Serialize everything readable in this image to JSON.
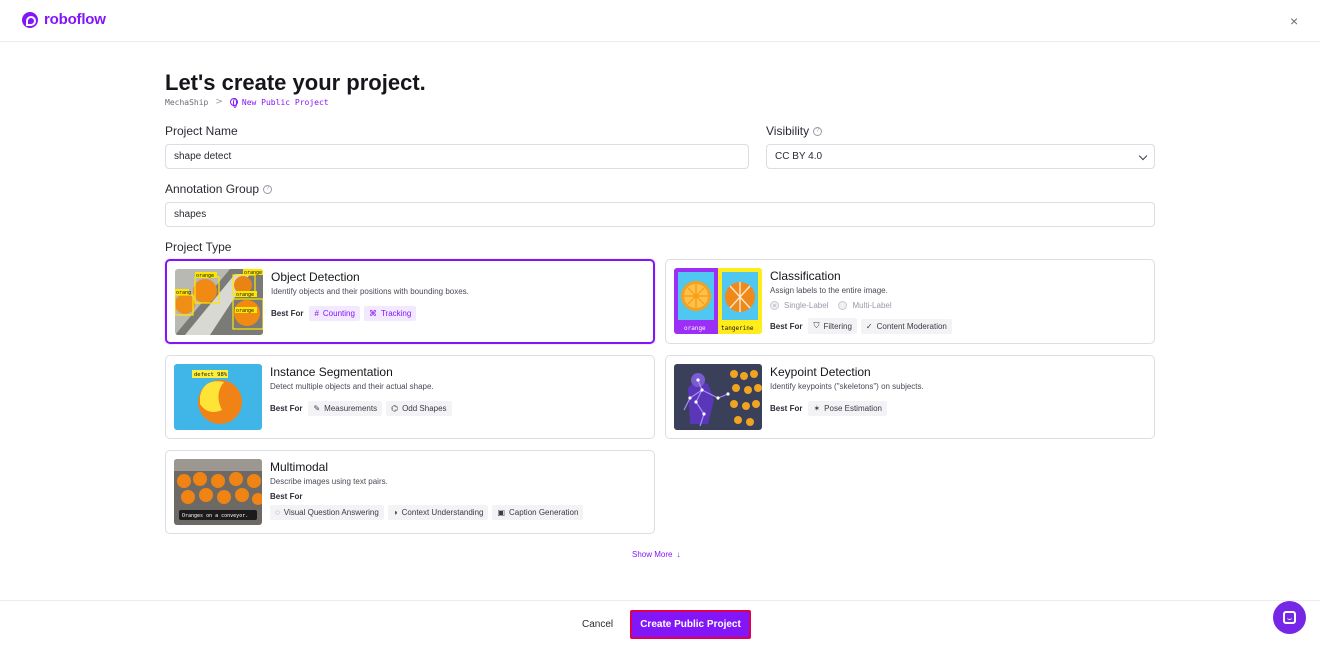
{
  "app": {
    "brand": "roboflow"
  },
  "header": {
    "close_icon": "close-icon",
    "close_glyph": "×"
  },
  "page": {
    "title": "Let's create your project.",
    "breadcrumb": {
      "workspace": "MechaShip",
      "separator": ">",
      "current": "New Public Project"
    }
  },
  "form": {
    "project_name": {
      "label": "Project Name",
      "value": "shape detect"
    },
    "visibility": {
      "label": "Visibility",
      "value": "CC BY 4.0"
    },
    "annotation_group": {
      "label": "Annotation Group",
      "value": "shapes"
    },
    "project_type_label": "Project Type"
  },
  "project_types": {
    "best_for_label": "Best For",
    "object_detection": {
      "title": "Object Detection",
      "description": "Identify objects and their positions with bounding boxes.",
      "tags": [
        {
          "icon": "#",
          "label": "Counting"
        },
        {
          "icon": "⌘",
          "label": "Tracking"
        }
      ],
      "selected": true,
      "thumb_labels": [
        "orange",
        "orange",
        "orang",
        "orange",
        "orange"
      ]
    },
    "classification": {
      "title": "Classification",
      "description": "Assign labels to the entire image.",
      "radio_single": "Single-Label",
      "radio_multi": "Multi-Label",
      "tags": [
        {
          "icon": "⛉",
          "label": "Filtering"
        },
        {
          "icon": "✓",
          "label": "Content Moderation"
        }
      ],
      "thumb_labels": [
        "orange",
        "tangerine"
      ]
    },
    "instance_segmentation": {
      "title": "Instance Segmentation",
      "description": "Detect multiple objects and their actual shape.",
      "tags": [
        {
          "icon": "✎",
          "label": "Measurements"
        },
        {
          "icon": "⌬",
          "label": "Odd Shapes"
        }
      ],
      "thumb_labels": [
        "defect 98%"
      ]
    },
    "keypoint_detection": {
      "title": "Keypoint Detection",
      "description": "Identify keypoints (\"skeletons\") on subjects.",
      "tags": [
        {
          "icon": "✶",
          "label": "Pose Estimation"
        }
      ]
    },
    "multimodal": {
      "title": "Multimodal",
      "description": "Describe images using text pairs.",
      "tags": [
        {
          "icon": "◌",
          "label": "Visual Question Answering"
        },
        {
          "icon": "◑",
          "label": "Context Understanding"
        },
        {
          "icon": "▣",
          "label": "Caption Generation"
        }
      ],
      "thumb_labels": [
        "Oranges on a conveyor."
      ]
    }
  },
  "show_more": "Show More",
  "footer": {
    "cancel": "Cancel",
    "create": "Create Public Project"
  },
  "colors": {
    "accent": "#8315f9",
    "highlight_border": "#e0004e",
    "chat": "#7626e6"
  }
}
